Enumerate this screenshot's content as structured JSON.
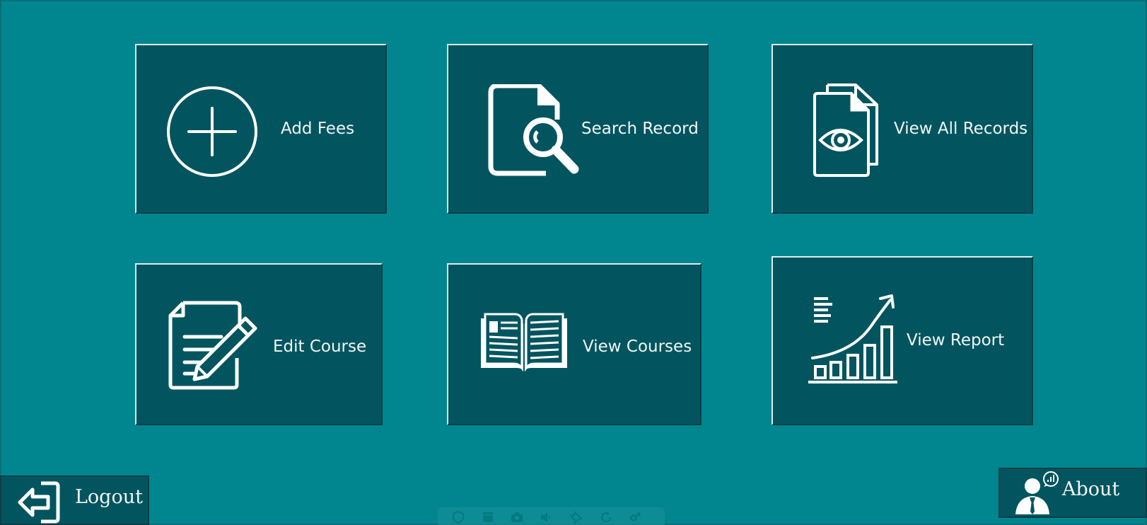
{
  "tiles": [
    {
      "name": "add-fees-tile",
      "label": "Add Fees",
      "icon": "add-circle-icon"
    },
    {
      "name": "search-record-tile",
      "label": "Search Record",
      "icon": "search-document-icon"
    },
    {
      "name": "view-all-records-tile",
      "label": "View All Records",
      "icon": "view-documents-icon"
    },
    {
      "name": "edit-course-tile",
      "label": "Edit Course",
      "icon": "edit-document-icon"
    },
    {
      "name": "view-courses-tile",
      "label": "View Courses",
      "icon": "open-book-icon"
    },
    {
      "name": "view-report-tile",
      "label": "View Report",
      "icon": "growth-chart-icon"
    }
  ],
  "footer": {
    "logout_label": "Logout",
    "about_label": "About"
  },
  "taskbar_icons": [
    "shield-icon",
    "clapper-icon",
    "camera-icon",
    "speaker-icon",
    "pin-icon",
    "refresh-icon",
    "gears-icon"
  ],
  "colors": {
    "background": "#01868f",
    "tile": "#02555f",
    "text": "#f2f6f7"
  }
}
